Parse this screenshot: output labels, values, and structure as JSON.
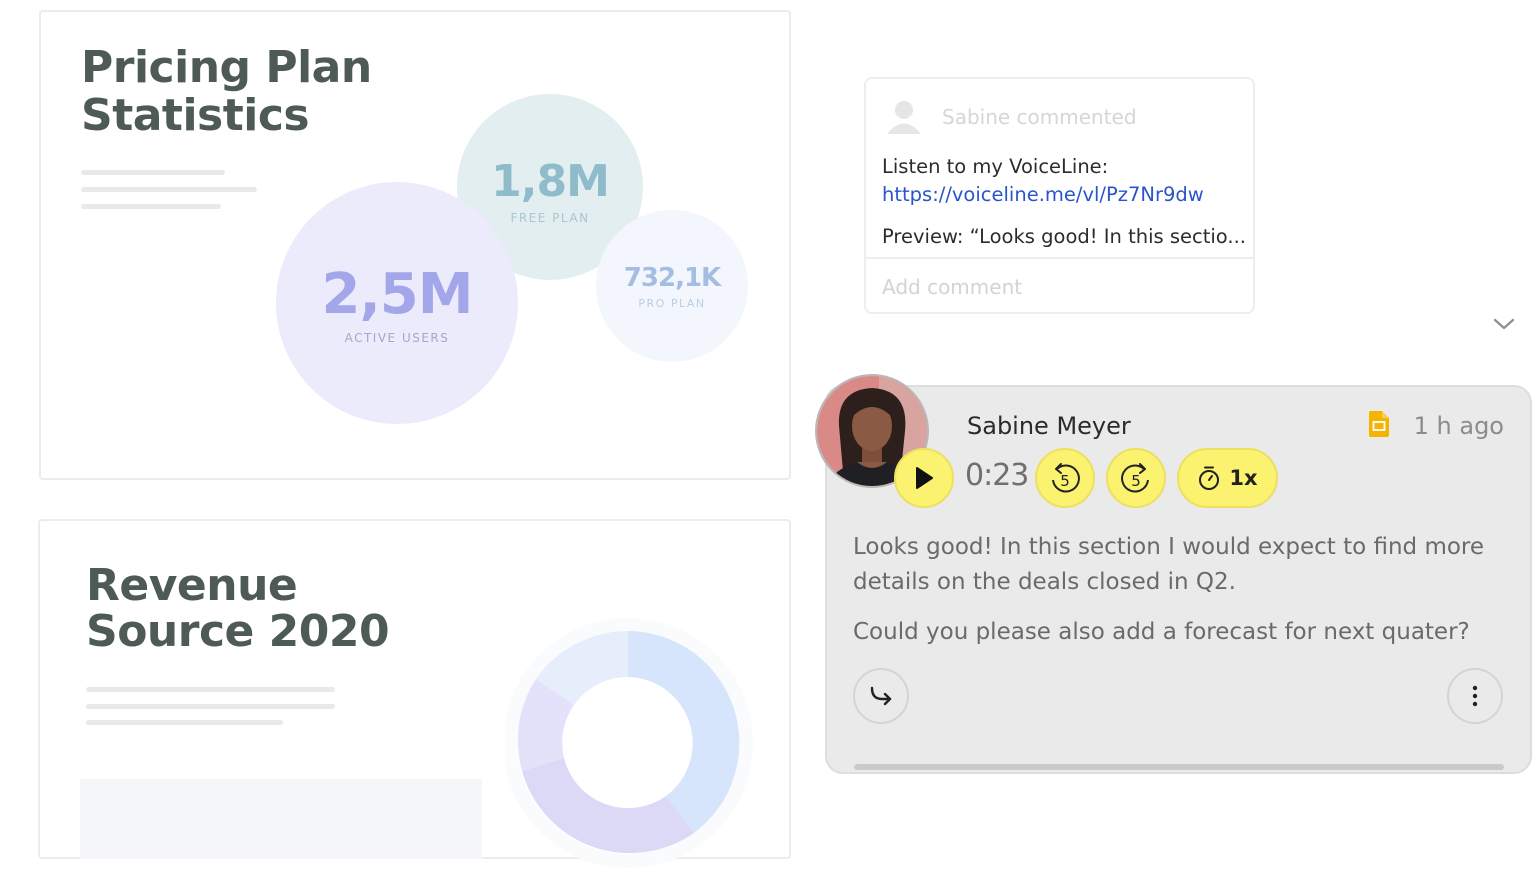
{
  "slides": {
    "pricing": {
      "title_line1": "Pricing Plan",
      "title_line2": "Statistics",
      "bubbles": [
        {
          "value": "2,5M",
          "caption": "ACTIVE USERS"
        },
        {
          "value": "1,8M",
          "caption": "FREE PLAN"
        },
        {
          "value": "732,1K",
          "caption": "PRO PLAN"
        }
      ]
    },
    "revenue": {
      "title_line1": "Revenue",
      "title_line2": "Source 2020"
    }
  },
  "comment": {
    "author": "Sabine commented",
    "body_prefix": "Listen to my VoiceLine: ",
    "link": "https://voiceline.me/vl/Pz7Nr9dw",
    "preview": "Preview: “Looks good! In this sectio...",
    "add_placeholder": "Add comment"
  },
  "voice": {
    "name": "Sabine Meyer",
    "time_ago": "1 h ago",
    "duration": "0:23",
    "rewind_seconds": "5",
    "forward_seconds": "5",
    "speed": "1x",
    "paragraph1": "Looks good! In this section I would expect to find more details on the deals closed in Q2.",
    "paragraph2": "Could you please also add a forecast for next quater?"
  },
  "colors": {
    "accent_yellow": "#fbf26f",
    "link_blue": "#2a55c9",
    "doc_icon": "#f4b400"
  }
}
